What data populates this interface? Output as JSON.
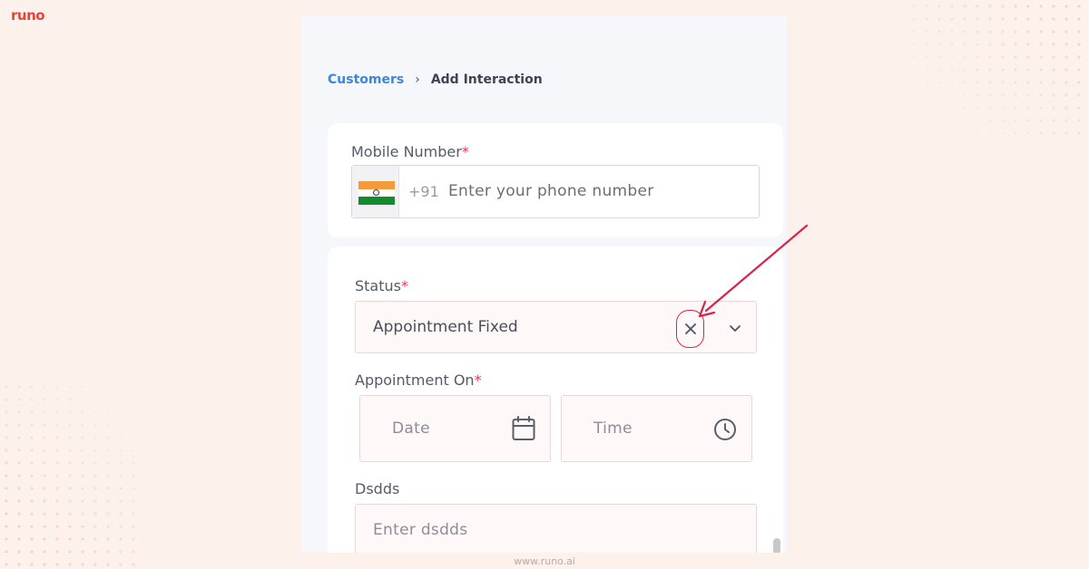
{
  "brand": {
    "logo_text": "runo",
    "footer_url": "www.runo.ai",
    "accent": "#e2453d"
  },
  "breadcrumb": {
    "parent": "Customers",
    "separator": "›",
    "current": "Add Interaction"
  },
  "mobile": {
    "label": "Mobile Number",
    "required_mark": "*",
    "country": "India",
    "dial_code": "+91",
    "placeholder": "Enter your phone number"
  },
  "status": {
    "label": "Status",
    "required_mark": "*",
    "value": "Appointment Fixed",
    "clear_icon": "close-icon",
    "dropdown_icon": "chevron-down-icon"
  },
  "appointment": {
    "label": "Appointment On",
    "required_mark": "*",
    "date_placeholder": "Date",
    "time_placeholder": "Time",
    "date_icon": "calendar-icon",
    "time_icon": "clock-icon"
  },
  "dsdds": {
    "label": "Dsdds",
    "placeholder": "Enter dsdds"
  },
  "colors": {
    "link": "#3c87d8",
    "required": "#e23a57",
    "highlight": "#d92349",
    "page_bg": "#fdf1ec"
  }
}
